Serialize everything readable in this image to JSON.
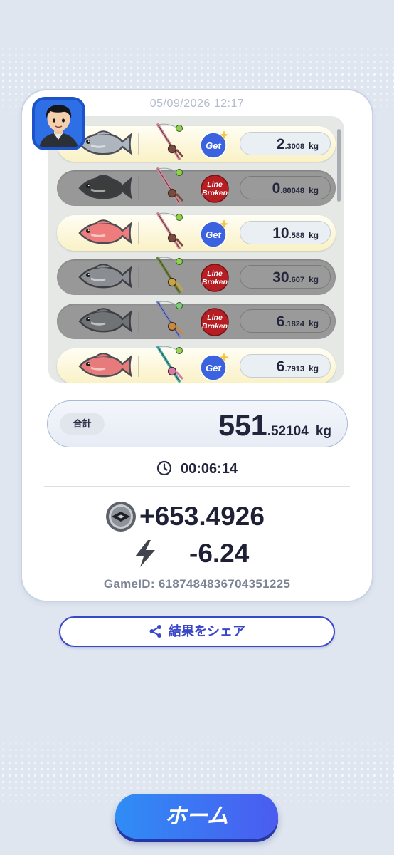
{
  "result": {
    "timestamp": "05/09/2026 12:17",
    "catches": [
      {
        "status": "get",
        "badge_line1": "Get",
        "badge_line2": "",
        "weight_int": "2",
        "weight_dec": ".3008",
        "unit": "kg",
        "fish_color": "#aeb5bd",
        "fish_name": "gray-fish-icon",
        "rod_name": "pink-rod-icon"
      },
      {
        "status": "broken",
        "badge_line1": "Line",
        "badge_line2": "Broken",
        "weight_int": "0",
        "weight_dec": ".80048",
        "unit": "kg",
        "fish_color": "#3a3d3c",
        "fish_name": "dark-fish-icon",
        "rod_name": "pink-rod-icon"
      },
      {
        "status": "get",
        "badge_line1": "Get",
        "badge_line2": "",
        "weight_int": "10",
        "weight_dec": ".588",
        "unit": "kg",
        "fish_color": "#ef7c7c",
        "fish_name": "red-snapper-icon",
        "rod_name": "pink-rod-icon"
      },
      {
        "status": "broken",
        "badge_line1": "Line",
        "badge_line2": "Broken",
        "weight_int": "30",
        "weight_dec": ".607",
        "unit": "kg",
        "fish_color": "#8a8e93",
        "fish_name": "grouper-icon",
        "rod_name": "green-rod-icon"
      },
      {
        "status": "broken",
        "badge_line1": "Line",
        "badge_line2": "Broken",
        "weight_int": "6",
        "weight_dec": ".1824",
        "unit": "kg",
        "fish_color": "#6f7376",
        "fish_name": "striped-fish-icon",
        "rod_name": "blue-rod-icon"
      },
      {
        "status": "get",
        "badge_line1": "Get",
        "badge_line2": "",
        "weight_int": "6",
        "weight_dec": ".7913",
        "unit": "kg",
        "fish_color": "#e77a7a",
        "fish_name": "red-rockfish-icon",
        "rod_name": "teal-rod-icon"
      }
    ],
    "total": {
      "label": "合計",
      "int": "551",
      "dec": ".52104",
      "unit": "kg"
    },
    "time": "00:06:14",
    "coins": "+653.4926",
    "energy": "-6.24",
    "game_id": "GameID: 6187484836704351225"
  },
  "buttons": {
    "share_label": "結果をシェア",
    "home_label": "ホーム"
  },
  "colors": {
    "get_badge": "#3b63e0",
    "broken_badge": "#b51e23",
    "accent": "#3a47c9"
  }
}
